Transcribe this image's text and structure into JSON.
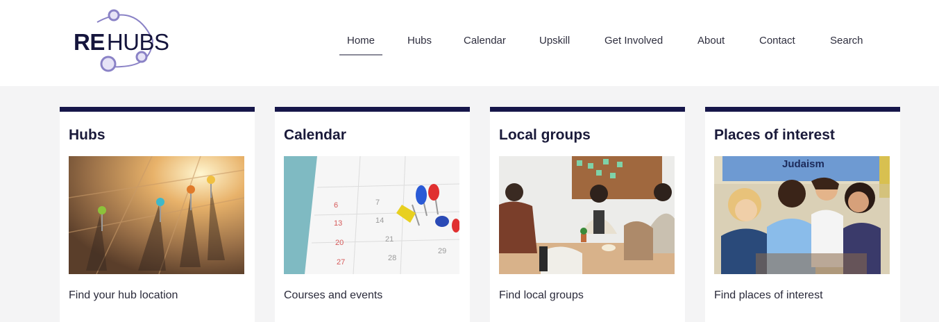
{
  "brand": {
    "logo_bold": "RE",
    "logo_light": "HUBS"
  },
  "nav": {
    "items": [
      {
        "label": "Home",
        "active": true
      },
      {
        "label": "Hubs"
      },
      {
        "label": "Calendar"
      },
      {
        "label": "Upskill"
      },
      {
        "label": "Get Involved"
      },
      {
        "label": "About"
      },
      {
        "label": "Contact"
      },
      {
        "label": "Search"
      }
    ]
  },
  "cards": [
    {
      "title": "Hubs",
      "link": "Find your hub location",
      "image_icon": "map-pins-photo"
    },
    {
      "title": "Calendar",
      "link": "Courses and events",
      "image_icon": "calendar-pins-photo",
      "calendar_numbers": [
        "6",
        "7",
        "13",
        "14",
        "20",
        "21",
        "28",
        "29",
        "27"
      ]
    },
    {
      "title": "Local groups",
      "link": "Find local groups",
      "image_icon": "meeting-photo"
    },
    {
      "title": "Places of interest",
      "link": "Find places of interest",
      "image_icon": "children-classroom-photo",
      "poster_text": "Judaism"
    }
  ],
  "colors": {
    "accent": "#16164a",
    "logo_nodes": "#8a82c6"
  }
}
